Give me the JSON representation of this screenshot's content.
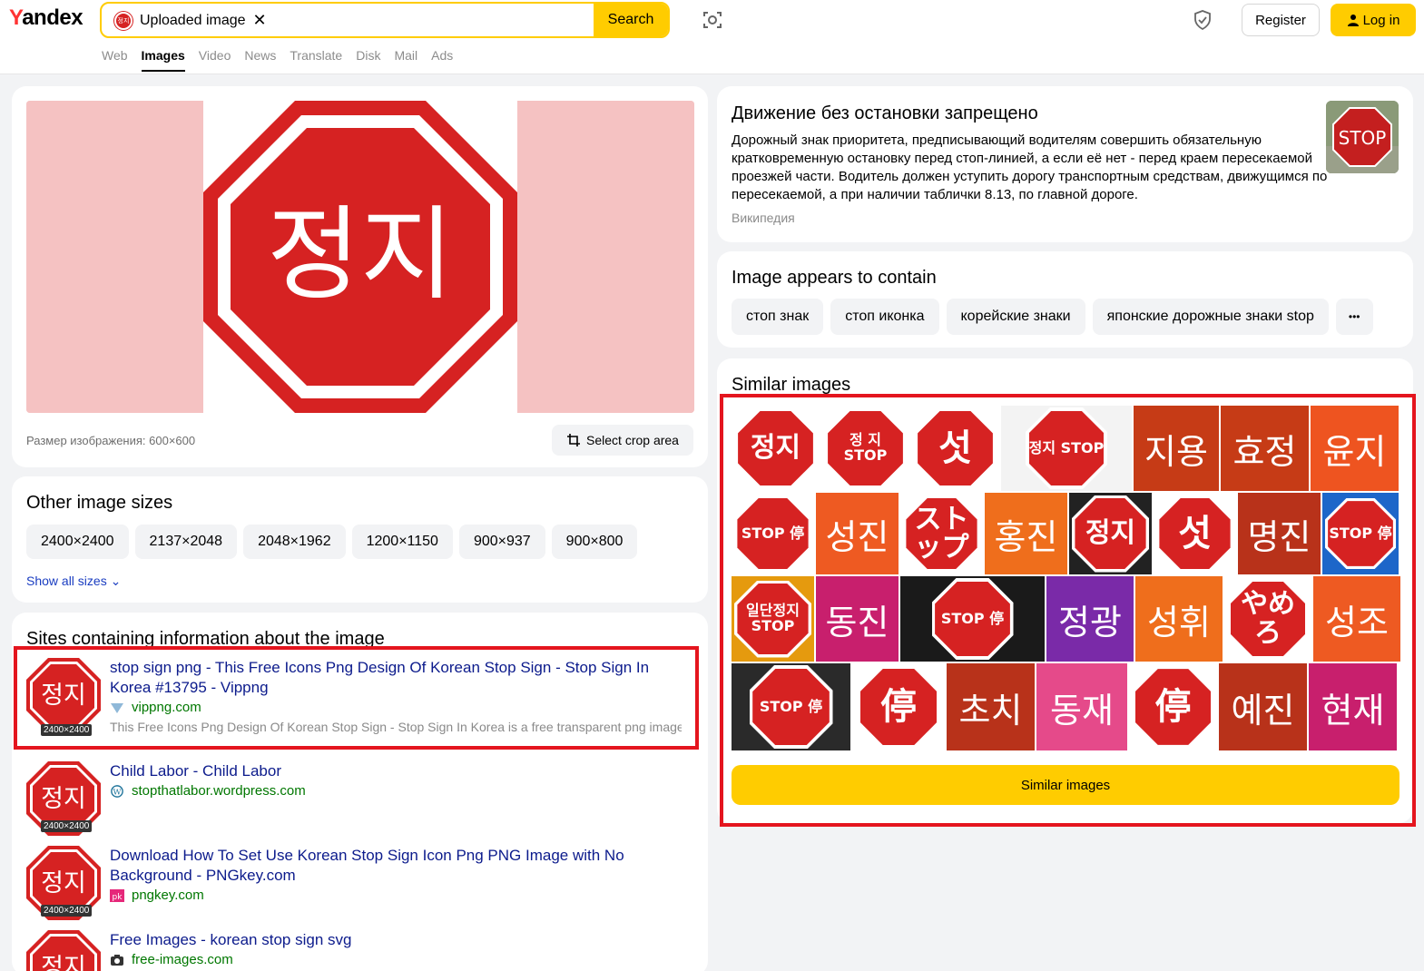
{
  "header": {
    "logo": "Yandex",
    "search_chip": "Uploaded image",
    "search_button": "Search",
    "register": "Register",
    "login": "Log in",
    "nav": [
      "Web",
      "Images",
      "Video",
      "News",
      "Translate",
      "Disk",
      "Mail",
      "Ads"
    ],
    "nav_active": "Images"
  },
  "main_image": {
    "text": "정지",
    "size_text": "Размер изображения: 600×600",
    "crop_button": "Select crop area",
    "colors": {
      "sign_red": "#d62222",
      "blur_pink": "#f5c2c2"
    }
  },
  "sizes": {
    "title": "Other image sizes",
    "items": [
      "2400×2400",
      "2137×2048",
      "2048×1962",
      "1200×1150",
      "900×937",
      "900×800"
    ],
    "show_all": "Show all sizes"
  },
  "sites": {
    "title": "Sites containing information about the image",
    "items": [
      {
        "title": "stop sign png - This Free Icons Png Design Of Korean Stop Sign - Stop Sign In Korea #13795 - Vippng",
        "url": "vippng.com",
        "desc": "This Free Icons Png Design Of Korean Stop Sign - Stop Sign In Korea is a free transparent png image.",
        "badge": "2400×2400",
        "favicon": "vippng-icon",
        "thumb_text": "정지"
      },
      {
        "title": "Child Labor - Child Labor",
        "url": "stopthatlabor.wordpress.com",
        "desc": "",
        "badge": "2400×2400",
        "favicon": "wordpress-icon",
        "thumb_text": "정지"
      },
      {
        "title": "Download How To Set Use Korean Stop Sign Icon Png PNG Image with No Background - PNGkey.com",
        "url": "pngkey.com",
        "desc": "",
        "badge": "2400×2400",
        "favicon": "pngkey-icon",
        "thumb_text": "정지"
      },
      {
        "title": "Free Images - korean stop sign svg",
        "url": "free-images.com",
        "desc": "",
        "badge": "",
        "favicon": "camera-icon",
        "thumb_text": "정지"
      }
    ]
  },
  "wiki": {
    "title": "Движение без остановки запрещено",
    "text": "Дорожный знак приоритета, предписывающий водителям совершить обязательную кратковременную остановку перед стоп-линией, а если её нет - перед краем пересекаемой проезжей части. Водитель должен уступить дорогу транспортным средствам, движущимся по пересекаемой, а при наличии таблички 8.13, по главной дороге.",
    "source": "Википедия",
    "image_text": "STOP"
  },
  "contains": {
    "title": "Image appears to contain",
    "tags": [
      "стоп знак",
      "стоп иконка",
      "корейские знаки",
      "японские дорожные знаки stop"
    ],
    "more": "•••"
  },
  "similar": {
    "title": "Similar images",
    "button": "Similar images",
    "tiles": [
      {
        "text": "정지",
        "kind": "oct",
        "bg": "#ffffff"
      },
      {
        "text": "정 지 STOP",
        "kind": "oct",
        "bg": "#ffffff"
      },
      {
        "text": "섯",
        "kind": "oct",
        "bg": "#ffffff"
      },
      {
        "text": "정지 STOP",
        "kind": "oct",
        "bg": "#f3f3f3"
      },
      {
        "text": "지용",
        "kind": "flat",
        "bg": "#c63b16"
      },
      {
        "text": "효정",
        "kind": "flat",
        "bg": "#c63b16"
      },
      {
        "text": "윤지",
        "kind": "flat",
        "bg": "#ee5420"
      },
      {
        "text": "STOP 停",
        "kind": "oct",
        "bg": "#ffffff"
      },
      {
        "text": "성진",
        "kind": "flat",
        "bg": "#ee5a22"
      },
      {
        "text": "ストップ",
        "kind": "oct",
        "bg": "#ffffff"
      },
      {
        "text": "홍진",
        "kind": "flat",
        "bg": "#ef6e1c"
      },
      {
        "text": "정지",
        "kind": "oct",
        "bg": "#222222"
      },
      {
        "text": "섯",
        "kind": "oct",
        "bg": "#ffffff"
      },
      {
        "text": "명진",
        "kind": "flat",
        "bg": "#b8321a"
      },
      {
        "text": "STOP 停",
        "kind": "oct",
        "bg": "#1d66c9"
      },
      {
        "text": "일단정지 STOP",
        "kind": "oct",
        "bg": "#e59a0e"
      },
      {
        "text": "동진",
        "kind": "flat",
        "bg": "#c81f6d"
      },
      {
        "text": "STOP 停",
        "kind": "oct",
        "bg": "#1a1a1a"
      },
      {
        "text": "정광",
        "kind": "flat",
        "bg": "#7a2aa8"
      },
      {
        "text": "성휘",
        "kind": "flat",
        "bg": "#ef6e1c"
      },
      {
        "text": "やめろ",
        "kind": "oct",
        "bg": "#ffffff"
      },
      {
        "text": "성조",
        "kind": "flat",
        "bg": "#ee5a22"
      },
      {
        "text": "STOP 停",
        "kind": "oct",
        "bg": "#2a2a2a"
      },
      {
        "text": "停",
        "kind": "oct",
        "bg": "#ffffff"
      },
      {
        "text": "초치",
        "kind": "flat",
        "bg": "#b8321a"
      },
      {
        "text": "동재",
        "kind": "flat",
        "bg": "#e54a8a"
      },
      {
        "text": "停",
        "kind": "oct",
        "bg": "#ffffff"
      },
      {
        "text": "예진",
        "kind": "flat",
        "bg": "#b8321a"
      },
      {
        "text": "현재",
        "kind": "flat",
        "bg": "#c81f6d"
      }
    ]
  }
}
